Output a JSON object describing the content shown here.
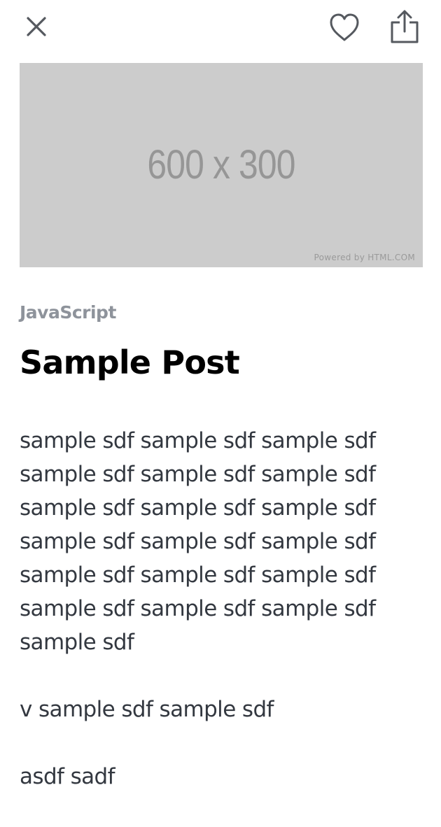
{
  "header": {
    "close_icon": "close-icon",
    "like_icon": "heart-outline-icon",
    "share_icon": "share-icon",
    "icon_color": "#55595f"
  },
  "hero": {
    "size_label": "600 x 300",
    "credit": "Powered by HTML.COM",
    "background": "#cccccc"
  },
  "post": {
    "category": "JavaScript",
    "title": "Sample Post",
    "paragraphs": [
      [
        "sample sdf sample sdf sample sdf",
        "sample sdf sample sdf sample sdf",
        "sample sdf sample sdf sample sdf",
        "sample sdf sample sdf sample sdf",
        "sample sdf sample sdf sample sdf",
        "sample sdf sample sdf sample sdf",
        "sample sdf"
      ],
      [
        "v sample sdf sample sdf"
      ],
      [
        "asdf sadf"
      ]
    ]
  }
}
